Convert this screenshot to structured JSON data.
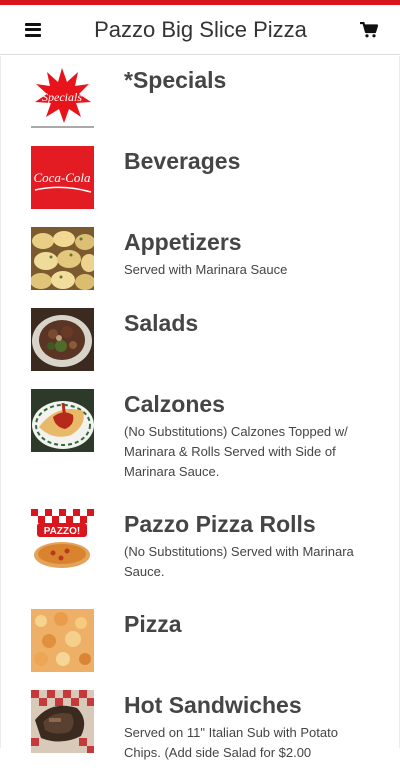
{
  "header": {
    "title": "Pazzo Big Slice Pizza",
    "menu_icon": "hamburger-menu-icon",
    "cart_icon": "shopping-cart-icon",
    "accent_color": "#d9161d"
  },
  "categories": [
    {
      "title": "*Specials",
      "description": "",
      "image": "specials-starburst-image"
    },
    {
      "title": "Beverages",
      "description": "",
      "image": "coca-cola-logo-image"
    },
    {
      "title": "Appetizers",
      "description": "Served with Marinara Sauce",
      "image": "garlic-knots-image"
    },
    {
      "title": "Salads",
      "description": "",
      "image": "salad-image"
    },
    {
      "title": "Calzones",
      "description": "(No Substitutions) Calzones Topped w/ Marinara & Rolls Served with Side of Marinara Sauce.",
      "image": "calzone-image"
    },
    {
      "title": "Pazzo Pizza Rolls",
      "description": "(No Substitutions) Served with Marinara Sauce.",
      "image": "pizza-rolls-image"
    },
    {
      "title": "Pizza",
      "description": "",
      "image": "pizza-image"
    },
    {
      "title": "Hot Sandwiches",
      "description": "Served on 11\" Italian Sub with Potato Chips. (Add side Salad for $2.00",
      "image": "hot-sandwich-image"
    }
  ]
}
